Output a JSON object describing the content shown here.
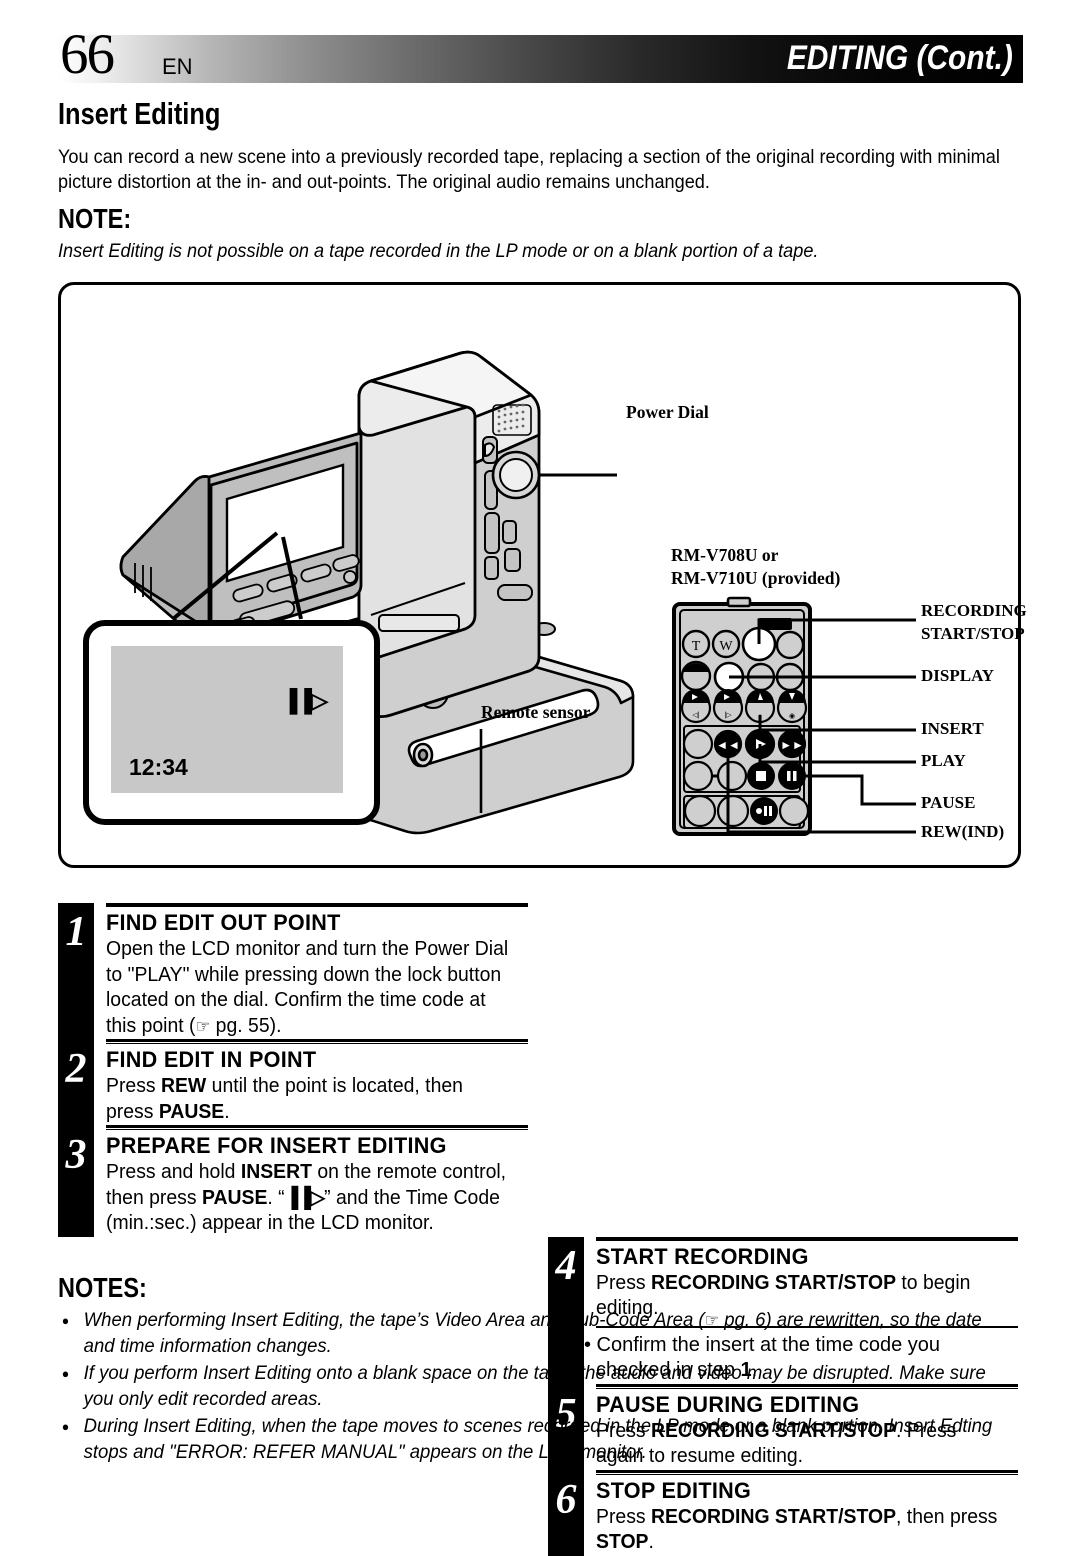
{
  "header": {
    "page_number": "66",
    "language": "EN",
    "title": "EDITING (Cont.)"
  },
  "section": {
    "title": "Insert Editing",
    "intro": "You can record a new scene into a previously recorded tape, replacing a section of the original recording with minimal picture distortion at the in- and out-points. The original audio remains unchanged.",
    "note_heading": "NOTE:",
    "note_text": "Insert Editing is not possible on a tape recorded in the LP mode or on a blank portion of a tape."
  },
  "illustration": {
    "labels": {
      "power_dial": "Power Dial",
      "remote_model_line1": "RM-V708U or",
      "remote_model_line2": "RM-V710U (provided)",
      "remote_sensor": "Remote sensor"
    },
    "lcd": {
      "status_icon": "pause-play-icon",
      "status_glyph": "▐▐▷",
      "time_code": "12:34"
    },
    "remote_buttons": {
      "zoom_tele": "T",
      "zoom_wide": "W"
    },
    "remote_callouts": [
      {
        "label": "RECORDING",
        "name": "recording-callout-line1"
      },
      {
        "label": "START/STOP",
        "name": "recording-callout-line2"
      },
      {
        "label": "DISPLAY",
        "name": "display-callout"
      },
      {
        "label": "INSERT",
        "name": "insert-callout"
      },
      {
        "label": "PLAY",
        "name": "play-callout"
      },
      {
        "label": "PAUSE",
        "name": "pause-callout"
      },
      {
        "label": "REW(IND)",
        "name": "rewind-callout"
      }
    ]
  },
  "steps_left": [
    {
      "num": "1",
      "title": "FIND EDIT OUT POINT",
      "body_parts": [
        {
          "t": "Open the LCD monitor and turn the Power Dial to \"PLAY\" while pressing down the lock button located on the dial. Confirm the time code at this point (",
          "b": false
        },
        {
          "t": "☞",
          "hand": true
        },
        {
          "t": " pg. 55).",
          "b": false
        }
      ]
    },
    {
      "num": "2",
      "title": "FIND EDIT IN POINT",
      "body_parts": [
        {
          "t": "Press ",
          "b": false
        },
        {
          "t": "REW",
          "b": true
        },
        {
          "t": " until the point is located, then press ",
          "b": false
        },
        {
          "t": "PAUSE",
          "b": true
        },
        {
          "t": ".",
          "b": false
        }
      ]
    },
    {
      "num": "3",
      "title": "PREPARE FOR INSERT EDITING",
      "body_parts": [
        {
          "t": "Press and hold ",
          "b": false
        },
        {
          "t": "INSERT",
          "b": true
        },
        {
          "t": " on the remote control, then press ",
          "b": false
        },
        {
          "t": "PAUSE",
          "b": true
        },
        {
          "t": ". “",
          "b": false
        },
        {
          "t": "▐▐▷",
          "glyph": true
        },
        {
          "t": "” and the Time Code (min.:sec.) appear in the LCD monitor.",
          "b": false
        }
      ]
    }
  ],
  "steps_right": [
    {
      "num": "4",
      "title": "START RECORDING",
      "body_parts": [
        {
          "t": "Press ",
          "b": false
        },
        {
          "t": "RECORDING START/STOP",
          "b": true
        },
        {
          "t": " to begin editing.",
          "b": false
        }
      ],
      "sub_bullet_parts": [
        {
          "t": "• Confirm the insert at the time code you checked in step ",
          "b": false
        },
        {
          "t": "1",
          "b": true
        },
        {
          "t": ".",
          "b": false
        }
      ]
    },
    {
      "num": "5",
      "title": "PAUSE DURING EDITING",
      "body_parts": [
        {
          "t": "Press ",
          "b": false
        },
        {
          "t": "RECORDING START/STOP",
          "b": true
        },
        {
          "t": ". Press again to resume editing.",
          "b": false
        }
      ]
    },
    {
      "num": "6",
      "title": "STOP EDITING",
      "body_parts": [
        {
          "t": "Press ",
          "b": false
        },
        {
          "t": "RECORDING START/STOP",
          "b": true
        },
        {
          "t": ", then press ",
          "b": false
        },
        {
          "t": "STOP",
          "b": true
        },
        {
          "t": ".",
          "b": false
        }
      ]
    }
  ],
  "notes": {
    "heading": "NOTES:",
    "items": [
      [
        {
          "t": "When performing Insert Editing, the tape’s Video Area and Sub-Code Area ("
        },
        {
          "t": "☞",
          "hand": true
        },
        {
          "t": " pg. 6) are rewritten, so the date and time information changes."
        }
      ],
      [
        {
          "t": "If you perform Insert Editing onto a blank space on the tape, the audio and video may be disrupted. Make sure you only edit recorded areas."
        }
      ],
      [
        {
          "t": "During Insert Editing, when the tape moves to scenes recorded in the LP mode or a blank portion, Insert Edting stops and \"ERROR: REFER MANUAL\" appears on the LCD monitor."
        }
      ]
    ]
  },
  "colors": {
    "ink": "#000000",
    "panel_border": "#000000",
    "lcd_screen": "#c8c8c8",
    "device_body": "#c9c9c9",
    "device_light": "#e4e4e4",
    "device_dark": "#9a9a9a"
  }
}
